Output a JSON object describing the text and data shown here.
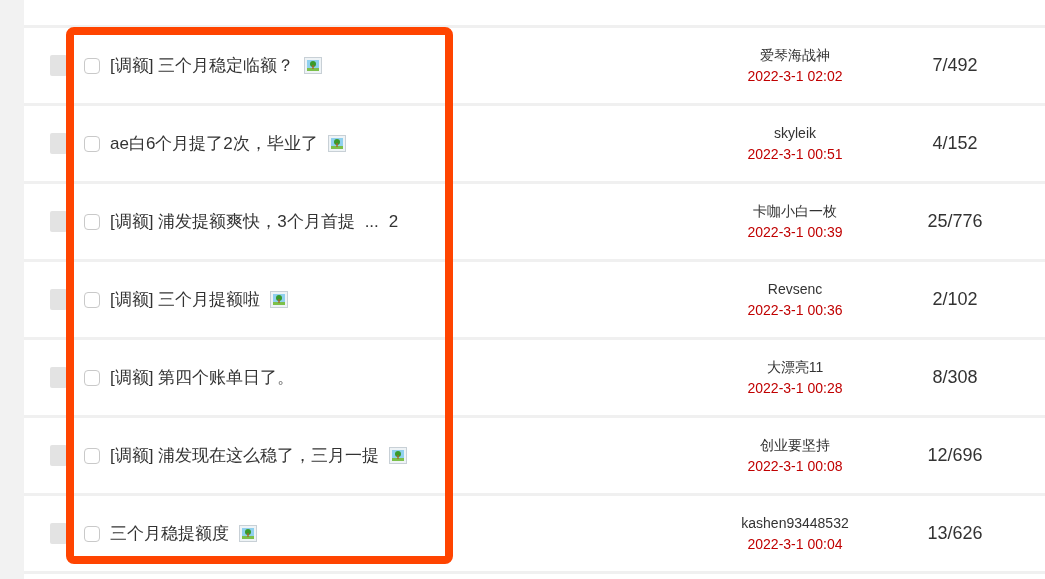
{
  "threads": [
    {
      "title": "[调额] 三个月稳定临额？",
      "has_image": true,
      "author": "爱琴海战神",
      "time": "2022-3-1 02:02",
      "replies_views": "7/492",
      "checked": false
    },
    {
      "title": "ae白6个月提了2次，毕业了",
      "has_image": true,
      "author": "skyleik",
      "time": "2022-3-1 00:51",
      "replies_views": "4/152",
      "checked": false
    },
    {
      "title": "[调额] 浦发提额爽快，3个月首提",
      "pages": [
        "...",
        "2"
      ],
      "has_image": false,
      "author": "卡咖小白一枚",
      "time": "2022-3-1 00:39",
      "replies_views": "25/776",
      "checked": false
    },
    {
      "title": "[调额] 三个月提额啦",
      "has_image": true,
      "author": "Revsenc",
      "time": "2022-3-1 00:36",
      "replies_views": "2/102",
      "checked": false
    },
    {
      "title": "[调额] 第四个账单日了。",
      "has_image": false,
      "author": "大漂亮11",
      "time": "2022-3-1 00:28",
      "replies_views": "8/308",
      "checked": false
    },
    {
      "title": "[调额] 浦发现在这么稳了，三月一提",
      "has_image": true,
      "author": "创业要坚持",
      "time": "2022-3-1 00:08",
      "replies_views": "12/696",
      "checked": false
    },
    {
      "title": "三个月稳提额度",
      "has_image": true,
      "author": "kashen93448532",
      "time": "2022-3-1 00:04",
      "replies_views": "13/626",
      "checked": false
    }
  ]
}
